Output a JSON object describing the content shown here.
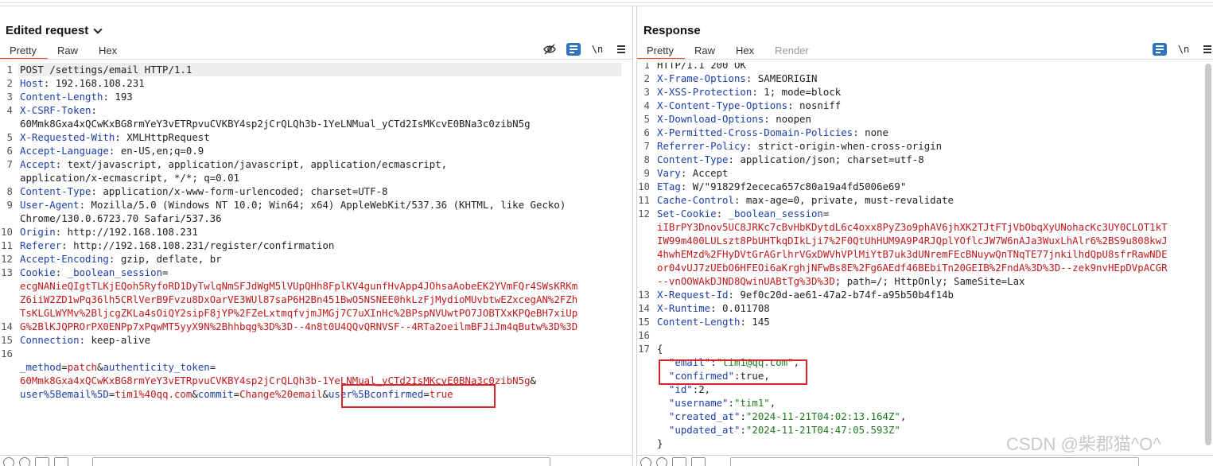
{
  "request": {
    "title": "Edited request",
    "tabs": [
      "Pretty",
      "Raw",
      "Hex"
    ],
    "newline_label": "\\n",
    "line_numbers": [
      "1",
      "2",
      "3",
      "4",
      "",
      "5",
      "6",
      "7",
      "",
      "8",
      "9",
      "",
      "10",
      "11",
      "12",
      "13",
      "",
      "",
      "",
      "14",
      "15",
      "16",
      "",
      ""
    ],
    "rows": [
      [
        {
          "t": "POST /settings/email HTTP/1.1",
          "c": "hv"
        }
      ],
      [
        {
          "t": "Host",
          "c": "hk"
        },
        {
          "t": ": 192.168.108.231",
          "c": "hv"
        }
      ],
      [
        {
          "t": "Content-Length",
          "c": "hk"
        },
        {
          "t": ": 193",
          "c": "hv"
        }
      ],
      [
        {
          "t": "X-CSRF-Token",
          "c": "hk"
        },
        {
          "t": ":",
          "c": "hv"
        }
      ],
      [
        {
          "t": "60Mmk8Gxa4xQCwKxBG8rmYeY3vETRpvuCVKBY4sp2jCrQLQh3b-1YeLNMual_yCTd2IsMKcvE0BNa3c0zibN5g",
          "c": "hv"
        }
      ],
      [
        {
          "t": "X-Requested-With",
          "c": "hk"
        },
        {
          "t": ": XMLHttpRequest",
          "c": "hv"
        }
      ],
      [
        {
          "t": "Accept-Language",
          "c": "hk"
        },
        {
          "t": ": en-US,en;q=0.9",
          "c": "hv"
        }
      ],
      [
        {
          "t": "Accept",
          "c": "hk"
        },
        {
          "t": ": text/javascript, application/javascript, application/ecmascript,",
          "c": "hv"
        }
      ],
      [
        {
          "t": "application/x-ecmascript, */*; q=0.01",
          "c": "hv"
        }
      ],
      [
        {
          "t": "Content-Type",
          "c": "hk"
        },
        {
          "t": ": application/x-www-form-urlencoded; charset=UTF-8",
          "c": "hv"
        }
      ],
      [
        {
          "t": "User-Agent",
          "c": "hk"
        },
        {
          "t": ": Mozilla/5.0 (Windows NT 10.0; Win64; x64) AppleWebKit/537.36 (KHTML, like Gecko)",
          "c": "hv"
        }
      ],
      [
        {
          "t": "Chrome/130.0.6723.70 Safari/537.36",
          "c": "hv"
        }
      ],
      [
        {
          "t": "Origin",
          "c": "hk"
        },
        {
          "t": ": http://192.168.108.231",
          "c": "hv"
        }
      ],
      [
        {
          "t": "Referer",
          "c": "hk"
        },
        {
          "t": ": http://192.168.108.231/register/confirmation",
          "c": "hv"
        }
      ],
      [
        {
          "t": "Accept-Encoding",
          "c": "hk"
        },
        {
          "t": ": gzip, deflate, br",
          "c": "hv"
        }
      ],
      [
        {
          "t": "Cookie",
          "c": "hk"
        },
        {
          "t": ": ",
          "c": "hv"
        },
        {
          "t": "_boolean_session",
          "c": "hk"
        },
        {
          "t": "=",
          "c": "hv"
        }
      ],
      [
        {
          "t": "ecgNANieQIgtTLKjEQoh5RyfoRD1DyTwlqNmSFJdWgM5lVUpQHh8FplKV4gunfHvApp4JOhsaAobeEK2YVmFQr4SWsKRKm",
          "c": "ck"
        }
      ],
      [
        {
          "t": "Z6iiW2ZD1wPq36lh5CRlVerB9Fvzu8DxOarVE3WUl87saP6H2Bn451BwO5NSNEE0hkLzFjMydioMUvbtwEZxcegAN%2FZh",
          "c": "ck"
        }
      ],
      [
        {
          "t": "TsKLGLWYMv%2BljcgZKLa4sOiQY2sipF8jYP%2FZeLxtmqfvjmJMGj7C7uXInHc%2BPspNVUwtPO7JOBTXxKPQeBH7xiUp",
          "c": "ck"
        }
      ],
      [
        {
          "t": "G%2BlKJQPROrPX0ENPp7xPqwMT5yyX9N%2Bhhbqg%3D%3D--4n8t0U4QQvQRNVSF--4RTa2oeilmBFJiJm4qButw%3D%3D",
          "c": "ck"
        }
      ],
      [
        {
          "t": "Connection",
          "c": "hk"
        },
        {
          "t": ": keep-alive",
          "c": "hv"
        }
      ],
      [
        {
          "t": "",
          "c": "hv"
        }
      ],
      [
        {
          "t": "_method",
          "c": "pk"
        },
        {
          "t": "=",
          "c": "hv"
        },
        {
          "t": "patch",
          "c": "pv"
        },
        {
          "t": "&",
          "c": "hv"
        },
        {
          "t": "authenticity_token",
          "c": "pk"
        },
        {
          "t": "=",
          "c": "hv"
        }
      ],
      [
        {
          "t": "60Mmk8Gxa4xQCwKxBG8rmYeY3vETRpvuCVKBY4sp2jCrQLQh3b-1YeLNMual_yCTd2IsMKcvE0BNa3c0zibN5g",
          "c": "pv"
        },
        {
          "t": "&",
          "c": "hv"
        }
      ],
      [
        {
          "t": "user%5Bemail%5D",
          "c": "pk"
        },
        {
          "t": "=",
          "c": "hv"
        },
        {
          "t": "tim1%40qq.com",
          "c": "pv"
        },
        {
          "t": "&",
          "c": "hv"
        },
        {
          "t": "commit",
          "c": "pk"
        },
        {
          "t": "=",
          "c": "hv"
        },
        {
          "t": "Change%20email",
          "c": "pv"
        },
        {
          "t": "&",
          "c": "hv"
        },
        {
          "t": "user%5Bconfirmed",
          "c": "pk"
        },
        {
          "t": "=",
          "c": "hv"
        },
        {
          "t": "true",
          "c": "pv"
        }
      ]
    ]
  },
  "response": {
    "title": "Response",
    "tabs": [
      "Pretty",
      "Raw",
      "Hex",
      "Render"
    ],
    "newline_label": "\\n",
    "line_numbers": [
      "1",
      "2",
      "3",
      "4",
      "5",
      "6",
      "7",
      "8",
      "9",
      "10",
      "11",
      "12",
      "",
      "",
      "",
      "",
      "",
      "13",
      "14",
      "15",
      "16",
      "17",
      "",
      "",
      "",
      "",
      "",
      "",
      ""
    ],
    "rows": [
      [
        {
          "t": "HTTP/1.1 200 OK",
          "c": "hv"
        }
      ],
      [
        {
          "t": "X-Frame-Options",
          "c": "hk"
        },
        {
          "t": ": SAMEORIGIN",
          "c": "hv"
        }
      ],
      [
        {
          "t": "X-XSS-Protection",
          "c": "hk"
        },
        {
          "t": ": 1; mode=block",
          "c": "hv"
        }
      ],
      [
        {
          "t": "X-Content-Type-Options",
          "c": "hk"
        },
        {
          "t": ": nosniff",
          "c": "hv"
        }
      ],
      [
        {
          "t": "X-Download-Options",
          "c": "hk"
        },
        {
          "t": ": noopen",
          "c": "hv"
        }
      ],
      [
        {
          "t": "X-Permitted-Cross-Domain-Policies",
          "c": "hk"
        },
        {
          "t": ": none",
          "c": "hv"
        }
      ],
      [
        {
          "t": "Referrer-Policy",
          "c": "hk"
        },
        {
          "t": ": strict-origin-when-cross-origin",
          "c": "hv"
        }
      ],
      [
        {
          "t": "Content-Type",
          "c": "hk"
        },
        {
          "t": ": application/json; charset=utf-8",
          "c": "hv"
        }
      ],
      [
        {
          "t": "Vary",
          "c": "hk"
        },
        {
          "t": ": Accept",
          "c": "hv"
        }
      ],
      [
        {
          "t": "ETag",
          "c": "hk"
        },
        {
          "t": ": W/\"91829f2ececa657c80a19a4fd5006e69\"",
          "c": "hv"
        }
      ],
      [
        {
          "t": "Cache-Control",
          "c": "hk"
        },
        {
          "t": ": max-age=0, private, must-revalidate",
          "c": "hv"
        }
      ],
      [
        {
          "t": "Set-Cookie",
          "c": "hk"
        },
        {
          "t": ": ",
          "c": "hv"
        },
        {
          "t": "_boolean_session",
          "c": "hk"
        },
        {
          "t": "=",
          "c": "hv"
        }
      ],
      [
        {
          "t": "iIBrPY3Dnov5UC8JRKc7cBvHbKDytdL6c4oxx8PyZ3o9phAV6jhXK2TJtFTjVbObqXyUNohacKc3UY0CLOT1kT",
          "c": "ck"
        }
      ],
      [
        {
          "t": "IW99m400LULszt8PbUHTkqDIkLji7%2F0QtUhHUM9A9P4RJQplYOflcJW7W6nAJa3WuxLhAlr6%2BS9u808kwJ",
          "c": "ck"
        }
      ],
      [
        {
          "t": "4hwhEMzd%2FHyDVtGrAGrlhrVGxDWVhVPlMiYtB7uk3dUNremFEcBNuywQnTNqTE77jnkilhdQpU8sfrRawNDE",
          "c": "ck"
        }
      ],
      [
        {
          "t": "or04vUJ7zUEbO6HFEOi6aKrghjNFwBs8E%2Fg6AEdf46BEbiTn20GEIB%2FndA%3D%3D--zek9nvHEpDVpACGR",
          "c": "ck"
        }
      ],
      [
        {
          "t": "--vnOOWAkDJND8QwinUABtTg%3D%3D",
          "c": "ck"
        },
        {
          "t": "; path=/; HttpOnly; SameSite=Lax",
          "c": "hv"
        }
      ],
      [
        {
          "t": "X-Request-Id",
          "c": "hk"
        },
        {
          "t": ": 9ef0c20d-ae61-47a2-b74f-a95b50b4f14b",
          "c": "hv"
        }
      ],
      [
        {
          "t": "X-Runtime",
          "c": "hk"
        },
        {
          "t": ": 0.011708",
          "c": "hv"
        }
      ],
      [
        {
          "t": "Content-Length",
          "c": "hk"
        },
        {
          "t": ": 145",
          "c": "hv"
        }
      ],
      [
        {
          "t": "",
          "c": "hv"
        }
      ],
      [
        {
          "t": "{",
          "c": "hv"
        }
      ],
      [
        {
          "t": "  \"email\"",
          "c": "jk"
        },
        {
          "t": ":",
          "c": "jv"
        },
        {
          "t": "\"tim1@qq.com\"",
          "c": "js"
        },
        {
          "t": ",",
          "c": "jv"
        }
      ],
      [
        {
          "t": "  \"confirmed\"",
          "c": "jk"
        },
        {
          "t": ":true,",
          "c": "jv"
        }
      ],
      [
        {
          "t": "  \"id\"",
          "c": "jk"
        },
        {
          "t": ":2,",
          "c": "jv"
        }
      ],
      [
        {
          "t": "  \"username\"",
          "c": "jk"
        },
        {
          "t": ":",
          "c": "jv"
        },
        {
          "t": "\"tim1\"",
          "c": "js"
        },
        {
          "t": ",",
          "c": "jv"
        }
      ],
      [
        {
          "t": "  \"created_at\"",
          "c": "jk"
        },
        {
          "t": ":",
          "c": "jv"
        },
        {
          "t": "\"2024-11-21T04:02:13.164Z\"",
          "c": "js"
        },
        {
          "t": ",",
          "c": "jv"
        }
      ],
      [
        {
          "t": "  \"updated_at\"",
          "c": "jk"
        },
        {
          "t": ":",
          "c": "jv"
        },
        {
          "t": "\"2024-11-21T04:47:05.593Z\"",
          "c": "js"
        }
      ],
      [
        {
          "t": "}",
          "c": "hv"
        }
      ]
    ]
  },
  "watermark": "CSDN @柴郡猫^O^",
  "icons": {
    "hide": "eye-slash-icon",
    "wrap": "wrap-lines-icon",
    "menu": "hamburger-menu-icon",
    "chevron": "chevron-down-icon"
  }
}
